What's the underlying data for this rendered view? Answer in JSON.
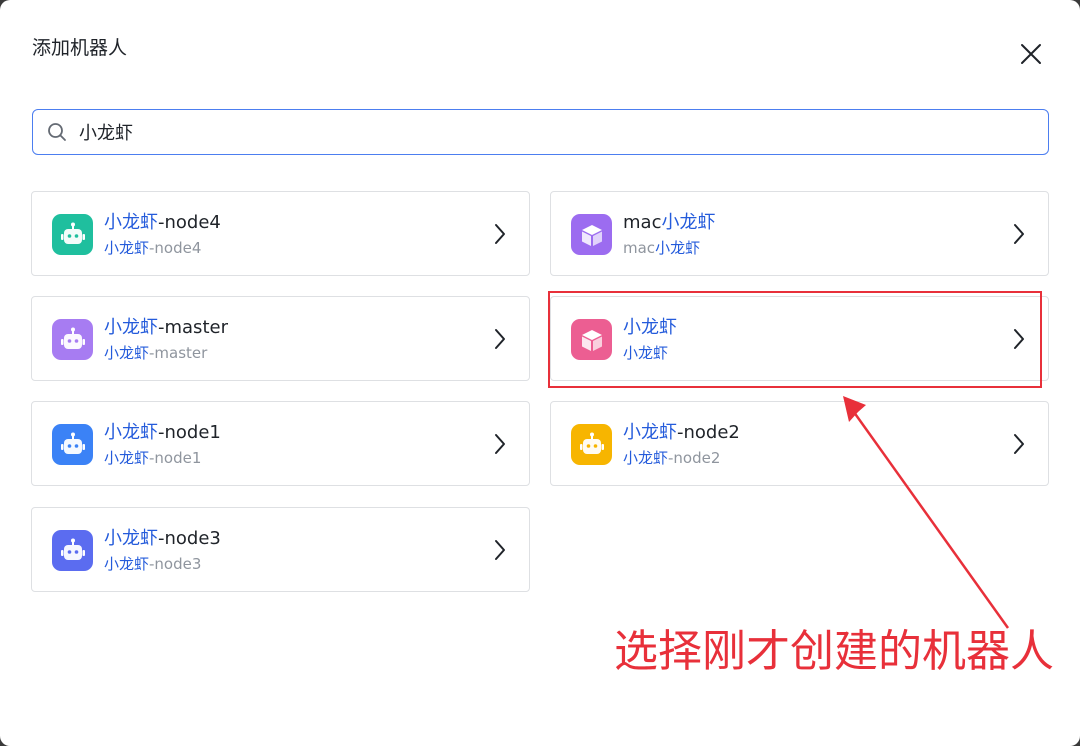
{
  "dialog": {
    "title": "添加机器人",
    "close_icon": "close-icon"
  },
  "search": {
    "icon": "search-icon",
    "value": "小龙虾",
    "placeholder": ""
  },
  "results": [
    {
      "name_hl": "小龙虾",
      "name_rest": "-node4",
      "sub_hl": "小龙虾",
      "sub_rest": "-node4",
      "icon": "robot-icon",
      "color": "#1fbf9e"
    },
    {
      "name_pre": "mac",
      "name_hl": "小龙虾",
      "name_rest": "",
      "sub_pre": "mac",
      "sub_hl": "小龙虾",
      "sub_rest": "",
      "icon": "cube-icon",
      "color": "#9c6cf0"
    },
    {
      "name_hl": "小龙虾",
      "name_rest": "-master",
      "sub_hl": "小龙虾",
      "sub_rest": "-master",
      "icon": "robot-icon",
      "color": "#a77cf2"
    },
    {
      "name_hl": "小龙虾",
      "name_rest": "",
      "sub_hl": "小龙虾",
      "sub_rest": "",
      "icon": "cube-icon",
      "color": "#ec5e92"
    },
    {
      "name_hl": "小龙虾",
      "name_rest": "-node1",
      "sub_hl": "小龙虾",
      "sub_rest": "-node1",
      "icon": "robot-icon",
      "color": "#3b82f6"
    },
    {
      "name_hl": "小龙虾",
      "name_rest": "-node2",
      "sub_hl": "小龙虾",
      "sub_rest": "-node2",
      "icon": "robot-icon",
      "color": "#f7b500"
    },
    {
      "name_hl": "小龙虾",
      "name_rest": "-node3",
      "sub_hl": "小龙虾",
      "sub_rest": "-node3",
      "icon": "robot-icon",
      "color": "#5b6cf0"
    }
  ],
  "annotation": {
    "text": "选择刚才创建的机器人",
    "color": "#e8303a"
  },
  "colors": {
    "accent": "#245bdb",
    "search_border": "#4c7ef0"
  }
}
